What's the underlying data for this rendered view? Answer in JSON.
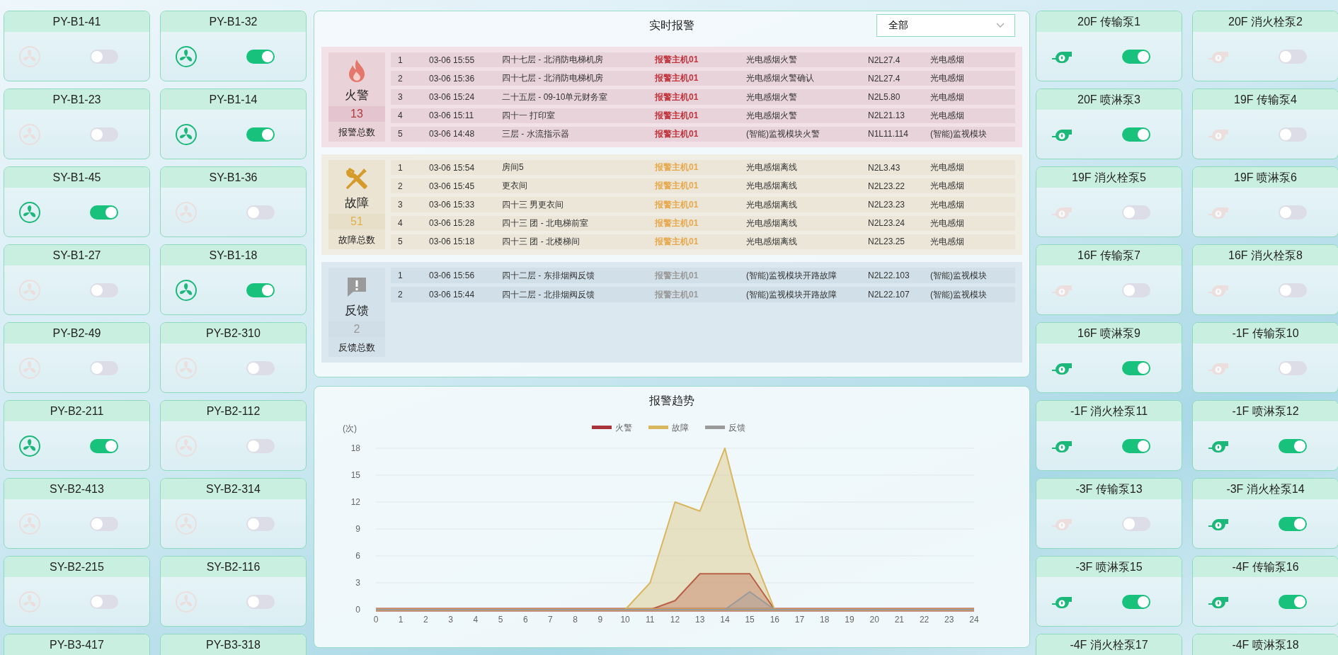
{
  "fan_panel": {
    "kind": "fan",
    "cards": [
      {
        "name": "PY-B1-41",
        "on": false
      },
      {
        "name": "PY-B1-32",
        "on": true
      },
      {
        "name": "PY-B1-23",
        "on": false
      },
      {
        "name": "PY-B1-14",
        "on": true
      },
      {
        "name": "SY-B1-45",
        "on": true
      },
      {
        "name": "SY-B1-36",
        "on": false
      },
      {
        "name": "SY-B1-27",
        "on": false
      },
      {
        "name": "SY-B1-18",
        "on": true
      },
      {
        "name": "PY-B2-49",
        "on": false
      },
      {
        "name": "PY-B2-310",
        "on": false
      },
      {
        "name": "PY-B2-211",
        "on": true
      },
      {
        "name": "PY-B2-112",
        "on": false
      },
      {
        "name": "SY-B2-413",
        "on": false
      },
      {
        "name": "SY-B2-314",
        "on": false
      },
      {
        "name": "SY-B2-215",
        "on": false
      },
      {
        "name": "SY-B2-116",
        "on": false
      },
      {
        "name": "PY-B3-417"
      },
      {
        "name": "PY-B3-318"
      }
    ]
  },
  "alarm_panel": {
    "title": "实时报警",
    "filter": {
      "value": "全部"
    },
    "sections": [
      {
        "kind": "fire",
        "name": "火警",
        "count": "13",
        "count_label": "报警总数",
        "rows": [
          {
            "index": "1",
            "time": "03-06 15:55",
            "location": "四十七层 - 北消防电梯机房",
            "host": "报警主机01",
            "event": "光电感烟火警",
            "code": "N2L27.4",
            "type": "光电感烟"
          },
          {
            "index": "2",
            "time": "03-06 15:36",
            "location": "四十七层 - 北消防电梯机房",
            "host": "报警主机01",
            "event": "光电感烟火警确认",
            "code": "N2L27.4",
            "type": "光电感烟"
          },
          {
            "index": "3",
            "time": "03-06 15:24",
            "location": "二十五层 - 09-10单元财务室",
            "host": "报警主机01",
            "event": "光电感烟火警",
            "code": "N2L5.80",
            "type": "光电感烟"
          },
          {
            "index": "4",
            "time": "03-06 15:11",
            "location": "四十一 打印室",
            "host": "报警主机01",
            "event": "光电感烟火警",
            "code": "N2L21.13",
            "type": "光电感烟"
          },
          {
            "index": "5",
            "time": "03-06 14:48",
            "location": "三层 - 水流指示器",
            "host": "报警主机01",
            "event": "(智能)监视模块火警",
            "code": "N1L11.114",
            "type": "(智能)监视模块"
          }
        ]
      },
      {
        "kind": "fault",
        "name": "故障",
        "count": "51",
        "count_label": "故障总数",
        "rows": [
          {
            "index": "1",
            "time": "03-06 15:54",
            "location": "房间5",
            "host": "报警主机01",
            "event": "光电感烟离线",
            "code": "N2L3.43",
            "type": "光电感烟"
          },
          {
            "index": "2",
            "time": "03-06 15:45",
            "location": "更衣间",
            "host": "报警主机01",
            "event": "光电感烟离线",
            "code": "N2L23.22",
            "type": "光电感烟"
          },
          {
            "index": "3",
            "time": "03-06 15:33",
            "location": "四十三 男更衣间",
            "host": "报警主机01",
            "event": "光电感烟离线",
            "code": "N2L23.23",
            "type": "光电感烟"
          },
          {
            "index": "4",
            "time": "03-06 15:28",
            "location": "四十三 团 - 北电梯前室",
            "host": "报警主机01",
            "event": "光电感烟离线",
            "code": "N2L23.24",
            "type": "光电感烟"
          },
          {
            "index": "5",
            "time": "03-06 15:18",
            "location": "四十三 团 - 北楼梯间",
            "host": "报警主机01",
            "event": "光电感烟离线",
            "code": "N2L23.25",
            "type": "光电感烟"
          }
        ]
      },
      {
        "kind": "feedback",
        "name": "反馈",
        "count": "2",
        "count_label": "反馈总数",
        "rows": [
          {
            "index": "1",
            "time": "03-06 15:56",
            "location": "四十二层 - 东排烟阀反馈",
            "host": "报警主机01",
            "event": "(智能)监视模块开路故障",
            "code": "N2L22.103",
            "type": "(智能)监视模块"
          },
          {
            "index": "2",
            "time": "03-06 15:44",
            "location": "四十二层 - 北排烟阀反馈",
            "host": "报警主机01",
            "event": "(智能)监视模块开路故障",
            "code": "N2L22.107",
            "type": "(智能)监视模块"
          }
        ]
      }
    ]
  },
  "trend_panel": {
    "title": "报警趋势",
    "chart_data": {
      "type": "area",
      "ylabel": "(次)",
      "grid": true,
      "legend": "top",
      "xlim": [
        0,
        24
      ],
      "x": [
        0,
        1,
        2,
        3,
        4,
        5,
        6,
        7,
        8,
        9,
        10,
        11,
        12,
        13,
        14,
        15,
        16,
        17,
        18,
        19,
        20,
        21,
        22,
        23,
        24
      ],
      "ylim": [
        0,
        18
      ],
      "yticks": [
        0,
        3,
        6,
        9,
        12,
        15,
        18
      ],
      "xticks": [
        0,
        1,
        2,
        3,
        4,
        5,
        6,
        7,
        8,
        9,
        10,
        11,
        12,
        13,
        14,
        15,
        16,
        17,
        18,
        19,
        20,
        21,
        22,
        23,
        24
      ],
      "series": [
        {
          "name": "火警",
          "color": "#a8333a",
          "values": [
            0,
            0,
            0,
            0,
            0,
            0,
            0,
            0,
            0,
            0,
            0,
            0,
            1,
            4,
            4,
            4,
            0,
            0,
            0,
            0,
            0,
            0,
            0,
            0,
            0
          ]
        },
        {
          "name": "故障",
          "color": "#d9b75e",
          "values": [
            0,
            0,
            0,
            0,
            0,
            0,
            0,
            0,
            0,
            0,
            0,
            3,
            12,
            11,
            18,
            7,
            0,
            0,
            0,
            0,
            0,
            0,
            0,
            0,
            0
          ]
        },
        {
          "name": "反馈",
          "color": "#9a9a9a",
          "values": [
            0,
            0,
            0,
            0,
            0,
            0,
            0,
            0,
            0,
            0,
            0,
            0,
            0,
            0,
            0,
            2,
            0,
            0,
            0,
            0,
            0,
            0,
            0,
            0,
            0
          ]
        }
      ]
    }
  },
  "pump_panel": {
    "kind": "pump",
    "cards": [
      {
        "name": "20F 传输泵1",
        "on": true
      },
      {
        "name": "20F 消火栓泵2",
        "on": false
      },
      {
        "name": "20F 喷淋泵3",
        "on": true
      },
      {
        "name": "19F 传输泵4",
        "on": false
      },
      {
        "name": "19F 消火栓泵5",
        "on": false
      },
      {
        "name": "19F 喷淋泵6",
        "on": false
      },
      {
        "name": "16F 传输泵7",
        "on": false
      },
      {
        "name": "16F 消火栓泵8",
        "on": false
      },
      {
        "name": "16F 喷淋泵9",
        "on": true
      },
      {
        "name": "-1F 传输泵10",
        "on": false
      },
      {
        "name": "-1F 消火栓泵11",
        "on": true
      },
      {
        "name": "-1F 喷淋泵12",
        "on": true
      },
      {
        "name": "-3F 传输泵13",
        "on": false
      },
      {
        "name": "-3F 消火栓泵14",
        "on": true
      },
      {
        "name": "-3F 喷淋泵15",
        "on": true
      },
      {
        "name": "-4F 传输泵16",
        "on": true
      },
      {
        "name": "-4F 消火栓泵17"
      },
      {
        "name": "-4F 喷淋泵18"
      }
    ]
  }
}
